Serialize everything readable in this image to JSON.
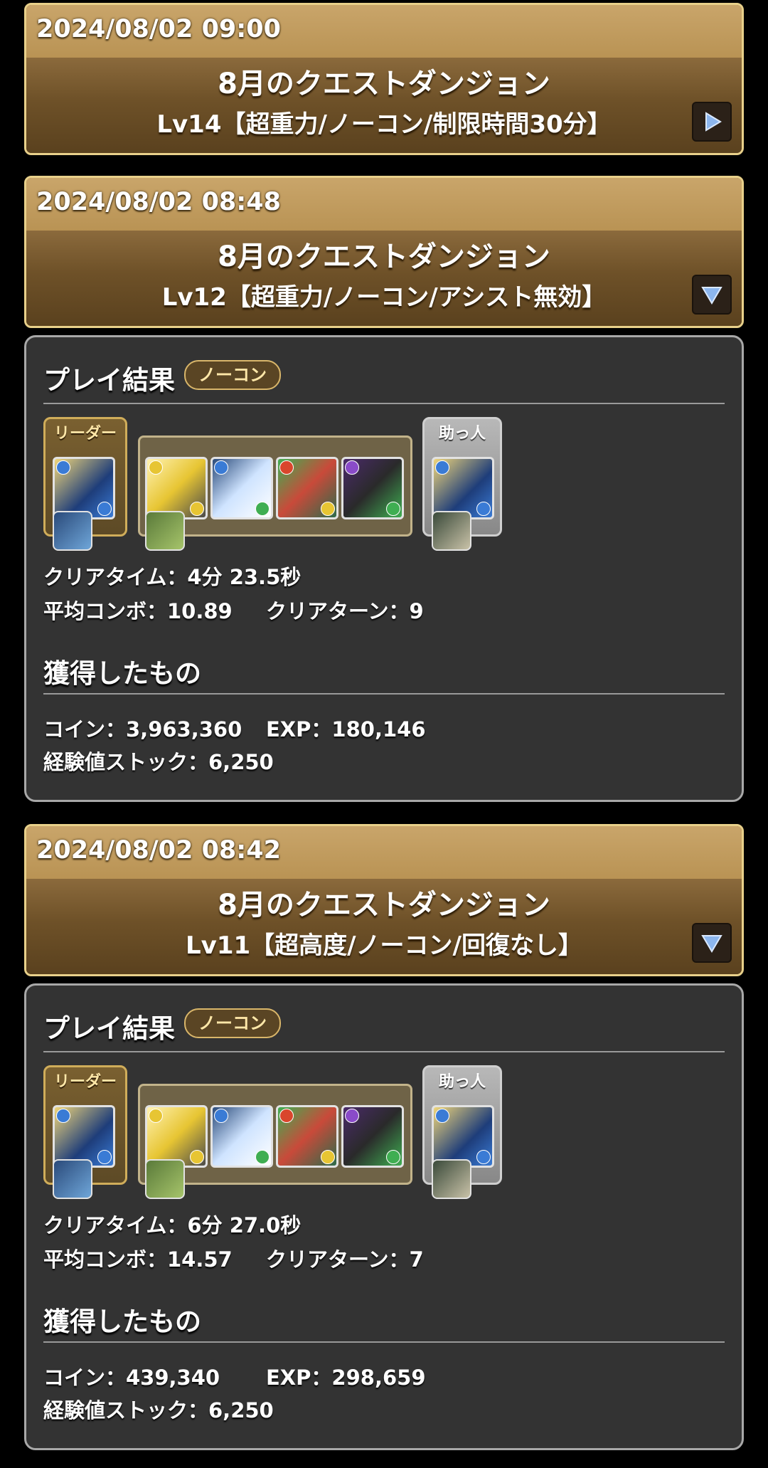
{
  "entries": [
    {
      "date": "2024/08/02 09:00",
      "title": "8月のクエストダンジョン",
      "subtitle": "Lv14【超重力/ノーコン/制限時間30分】",
      "toggle_icon": "play-right-icon"
    },
    {
      "date": "2024/08/02 08:48",
      "title": "8月のクエストダンジョン",
      "subtitle": "Lv12【超重力/ノーコン/アシスト無効】",
      "toggle_icon": "triangle-down-icon",
      "result": {
        "heading": "プレイ結果",
        "badge": "ノーコン",
        "leader_label": "リーダー",
        "helper_label": "助っ人",
        "clear_time": "クリアタイム：4分 23.5秒",
        "avg_combo": "平均コンボ：10.89",
        "clear_turn": "クリアターン：9",
        "loot_heading": "獲得したもの",
        "coin": "コイン：3,963,360",
        "exp": "EXP：180,146",
        "exp_stock": "経験値ストック：6,250"
      }
    },
    {
      "date": "2024/08/02 08:42",
      "title": "8月のクエストダンジョン",
      "subtitle": "Lv11【超高度/ノーコン/回復なし】",
      "toggle_icon": "triangle-down-icon",
      "result": {
        "heading": "プレイ結果",
        "badge": "ノーコン",
        "leader_label": "リーダー",
        "helper_label": "助っ人",
        "clear_time": "クリアタイム：6分 27.0秒",
        "avg_combo": "平均コンボ：14.57",
        "clear_turn": "クリアターン：7",
        "loot_heading": "獲得したもの",
        "coin": "コイン：439,340",
        "exp": "EXP：298,659",
        "exp_stock": "経験値ストック：6,250"
      }
    }
  ],
  "colors": {
    "header_gold": "#c9a56a",
    "header_brown": "#6e5128",
    "panel_bg": "#333333",
    "water_orb": "#3a7bd5",
    "light_orb": "#e7c533",
    "wood_orb": "#3fae52",
    "fire_orb": "#d9462c",
    "dark_orb": "#8a4bc9"
  }
}
